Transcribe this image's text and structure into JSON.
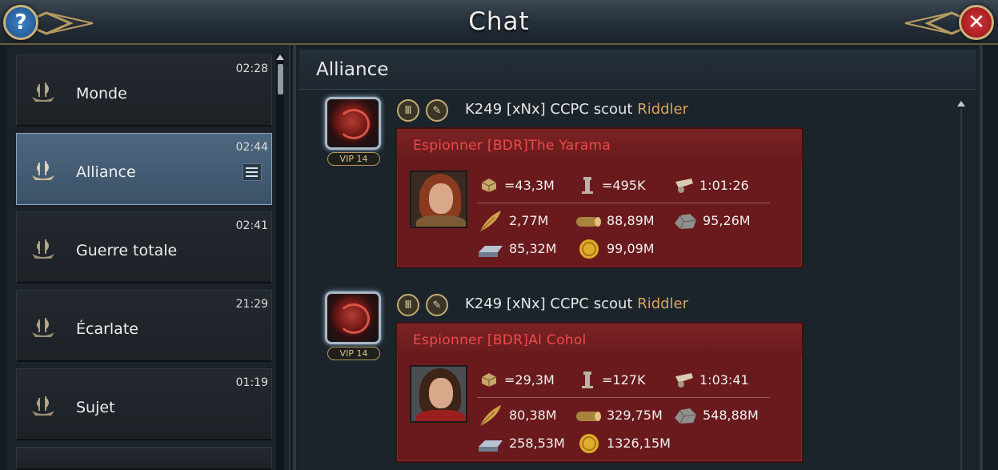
{
  "window": {
    "title": "Chat",
    "help_label": "?",
    "close_label": "✕"
  },
  "sidebar": {
    "channels": [
      {
        "label": "Monde",
        "time": "02:28",
        "active": false
      },
      {
        "label": "Alliance",
        "time": "02:44",
        "active": true
      },
      {
        "label": "Guerre totale",
        "time": "02:41",
        "active": false
      },
      {
        "label": "Écarlate",
        "time": "21:29",
        "active": false
      },
      {
        "label": "Sujet",
        "time": "01:19",
        "active": false
      }
    ]
  },
  "main": {
    "header": "Alliance",
    "messages": [
      {
        "vip": "VIP 14",
        "sender_prefix": "K249 [xNx] CCPC scout ",
        "sender_name": "Riddler",
        "report_title": "Espionner [BDR]The Yarama",
        "troops": "=43,3M",
        "tower": "=495K",
        "march_time": "1:01:26",
        "food": "2,77M",
        "wood": "88,89M",
        "stone": "95,26M",
        "iron": "85,32M",
        "gold": "99,09M"
      },
      {
        "vip": "VIP 14",
        "sender_prefix": "K249 [xNx] CCPC scout ",
        "sender_name": "Riddler",
        "report_title": "Espionner [BDR]Al Cohol",
        "troops": "=29,3M",
        "tower": "=127K",
        "march_time": "1:03:41",
        "food": "80,38M",
        "wood": "329,75M",
        "stone": "548,88M",
        "iron": "258,53M",
        "gold": "1326,15M"
      }
    ]
  },
  "colors": {
    "accent_gold": "#d7a45b",
    "report_red": "#ec4b4b",
    "active_channel": "#4e6780"
  },
  "icons": {
    "help": "question-icon",
    "close": "close-icon",
    "channel": "ship-icon",
    "menu": "list-menu-icon",
    "badge_1": "colonnade-icon",
    "badge_2": "quill-icon",
    "troops": "box-icon",
    "tower": "tower-icon",
    "march": "cannon-icon",
    "food": "feather-icon",
    "wood": "log-icon",
    "stone": "stone-icon",
    "iron": "iron-ingot-icon",
    "gold": "gold-coin-icon"
  }
}
